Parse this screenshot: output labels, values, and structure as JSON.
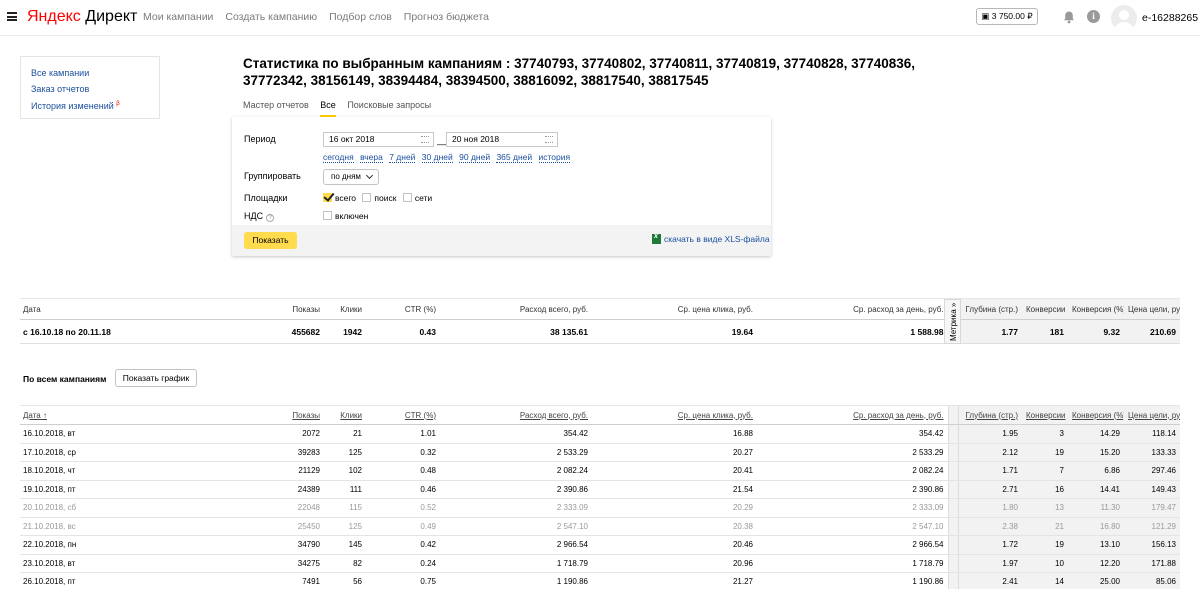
{
  "header": {
    "logo_ya": "Яндекс",
    "logo_direct": "Директ",
    "nav": [
      "Мои кампании",
      "Создать кампанию",
      "Подбор слов",
      "Прогноз бюджета"
    ],
    "balance": "3 750.00 ₽",
    "login": "e-16288265"
  },
  "sidebar": {
    "items": [
      {
        "label": "Все кампании"
      },
      {
        "label": "Заказ отчетов"
      },
      {
        "label": "История изменений",
        "badge": "β"
      }
    ]
  },
  "page": {
    "title": "Статистика по выбранным кампаниям : 37740793, 37740802, 37740811, 37740819, 37740828, 37740836, 37772342, 38156149, 38394484, 38394500, 38816092, 38817540, 38817545",
    "tabs": [
      {
        "label": "Мастер отчетов",
        "active": false
      },
      {
        "label": "Все",
        "active": true
      },
      {
        "label": "Поисковые запросы",
        "active": false
      }
    ]
  },
  "form": {
    "period_label": "Период",
    "date_from": "16 окт 2018",
    "date_to": "20 ноя 2018",
    "dash": "—",
    "quick_periods": [
      "сегодня",
      "вчера",
      "7 дней",
      "30 дней",
      "90 дней",
      "365 дней",
      "история"
    ],
    "group_label": "Группировать",
    "group_value": "по дням",
    "platforms_label": "Площадки",
    "platforms": [
      {
        "label": "всего",
        "checked": true
      },
      {
        "label": "поиск",
        "checked": false
      },
      {
        "label": "сети",
        "checked": false
      }
    ],
    "vat_label": "НДС",
    "vat_help": "?",
    "vat_checkbox_label": "включен",
    "show_button": "Показать",
    "xls_link": "скачать в виде XLS-файла"
  },
  "summary_table": {
    "headers": [
      "Дата",
      "Показы",
      "Клики",
      "CTR (%)",
      "Расход всего, руб.",
      "Ср. цена клика, руб.",
      "Ср. расход за день, руб.",
      "",
      "Глубина (стр.)",
      "Конверсии",
      "Конверсия (%)",
      "Цена цели, руб."
    ],
    "row": [
      "с 16.10.18 по 20.11.18",
      "455682",
      "1942",
      "0.43",
      "38 135.61",
      "19.64",
      "1 588.98",
      "",
      "1.77",
      "181",
      "9.32",
      "210.69"
    ],
    "metrika_label": "Метрика »"
  },
  "section": {
    "title": "По всем кампаниям",
    "graph_button": "Показать график"
  },
  "detail_table": {
    "headers": [
      "Дата ↑",
      "Показы",
      "Клики",
      "CTR (%)",
      "Расход всего, руб.",
      "Ср. цена клика, руб.",
      "Ср. расход за день, руб.",
      "",
      "Глубина (стр.)",
      "Конверсии",
      "Конверсия (%)",
      "Цена цели, руб."
    ],
    "rows": [
      {
        "weekend": false,
        "cells": [
          "16.10.2018, вт",
          "2072",
          "21",
          "1.01",
          "354.42",
          "16.88",
          "354.42",
          "",
          "1.95",
          "3",
          "14.29",
          "118.14"
        ]
      },
      {
        "weekend": false,
        "cells": [
          "17.10.2018, ср",
          "39283",
          "125",
          "0.32",
          "2 533.29",
          "20.27",
          "2 533.29",
          "",
          "2.12",
          "19",
          "15.20",
          "133.33"
        ]
      },
      {
        "weekend": false,
        "cells": [
          "18.10.2018, чт",
          "21129",
          "102",
          "0.48",
          "2 082.24",
          "20.41",
          "2 082.24",
          "",
          "1.71",
          "7",
          "6.86",
          "297.46"
        ]
      },
      {
        "weekend": false,
        "cells": [
          "19.10.2018, пт",
          "24389",
          "111",
          "0.46",
          "2 390.86",
          "21.54",
          "2 390.86",
          "",
          "2.71",
          "16",
          "14.41",
          "149.43"
        ]
      },
      {
        "weekend": true,
        "cells": [
          "20.10.2018, сб",
          "22048",
          "115",
          "0.52",
          "2 333.09",
          "20.29",
          "2 333.09",
          "",
          "1.80",
          "13",
          "11.30",
          "179.47"
        ]
      },
      {
        "weekend": true,
        "cells": [
          "21.10.2018, вс",
          "25450",
          "125",
          "0.49",
          "2 547.10",
          "20.38",
          "2 547.10",
          "",
          "2.38",
          "21",
          "16.80",
          "121.29"
        ]
      },
      {
        "weekend": false,
        "cells": [
          "22.10.2018, пн",
          "34790",
          "145",
          "0.42",
          "2 966.54",
          "20.46",
          "2 966.54",
          "",
          "1.72",
          "19",
          "13.10",
          "156.13"
        ]
      },
      {
        "weekend": false,
        "cells": [
          "23.10.2018, вт",
          "34275",
          "82",
          "0.24",
          "1 718.79",
          "20.96",
          "1 718.79",
          "",
          "1.97",
          "10",
          "12.20",
          "171.88"
        ]
      },
      {
        "weekend": false,
        "cells": [
          "26.10.2018, пт",
          "7491",
          "56",
          "0.75",
          "1 190.86",
          "21.27",
          "1 190.86",
          "",
          "2.41",
          "14",
          "25.00",
          "85.06"
        ]
      }
    ]
  },
  "colors": {
    "link": "#1a4f9e",
    "accent": "#ffdb4d",
    "logo_red": "#ff0000"
  }
}
